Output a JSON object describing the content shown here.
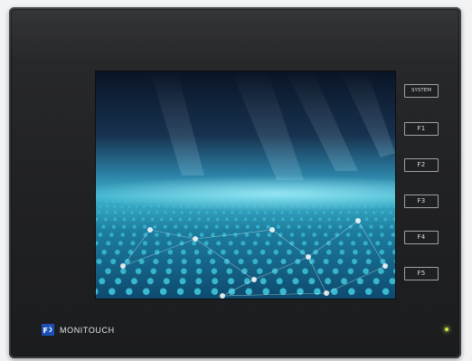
{
  "device": {
    "brand_text": "MONITOUCH",
    "logo_icon": "fuji-electric-logo-icon",
    "status_led_color": "#c9e64a"
  },
  "function_keys": [
    {
      "label": "SYSTEM"
    },
    {
      "label": "F1"
    },
    {
      "label": "F2"
    },
    {
      "label": "F3"
    },
    {
      "label": "F4"
    },
    {
      "label": "F5"
    }
  ],
  "screen": {
    "content": "blue-network-mesh-wallpaper",
    "accent_color": "#46d4e8"
  }
}
